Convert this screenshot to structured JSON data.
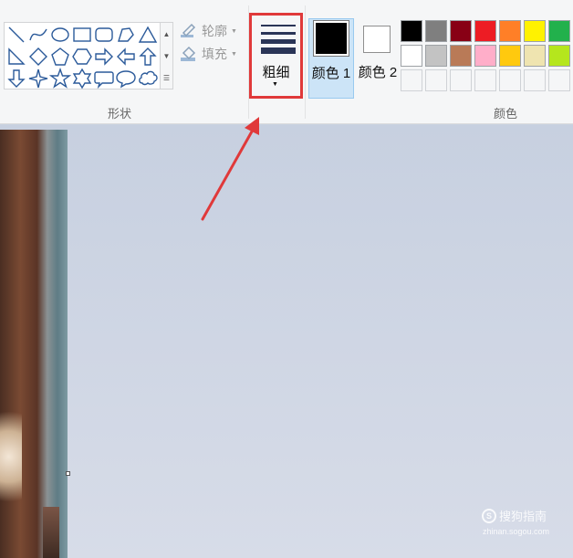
{
  "ribbon": {
    "groups": {
      "shapes": "形状",
      "colors": "颜色"
    },
    "shapes_group": {
      "outline_label": "轮廓",
      "fill_label": "填充",
      "shapes": [
        "line-shape-icon",
        "curve-shape-icon",
        "oval-shape-icon",
        "rectangle-shape-icon",
        "rounded-rectangle-shape-icon",
        "polygon-shape-icon",
        "triangle-shape-icon",
        "right-triangle-shape-icon",
        "diamond-shape-icon",
        "pentagon-shape-icon",
        "hexagon-shape-icon",
        "right-arrow-shape-icon",
        "left-arrow-shape-icon",
        "up-arrow-shape-icon",
        "down-arrow-shape-icon",
        "four-point-star-shape-icon",
        "five-point-star-shape-icon",
        "six-point-star-shape-icon",
        "rounded-callout-shape-icon",
        "oval-callout-shape-icon",
        "cloud-callout-shape-icon"
      ]
    },
    "size": {
      "label": "粗细"
    },
    "color1": {
      "label": "颜色 1",
      "color": "#000000"
    },
    "color2": {
      "label": "颜色 2",
      "color": "#ffffff"
    },
    "palette": {
      "row1": [
        "#000000",
        "#7f7f7f",
        "#880015",
        "#ed1c24",
        "#ff7f27",
        "#fff200",
        "#22b14c"
      ],
      "row2": [
        "#ffffff",
        "#c3c3c3",
        "#b97a57",
        "#ffaec9",
        "#ffc90e",
        "#efe4b0",
        "#b5e61d"
      ],
      "row3_empty_count": 7
    }
  },
  "watermark": {
    "line1": "搜狗指南",
    "line2": "zhinan.sogou.com"
  },
  "annotation": {
    "color": "#e0393a"
  }
}
